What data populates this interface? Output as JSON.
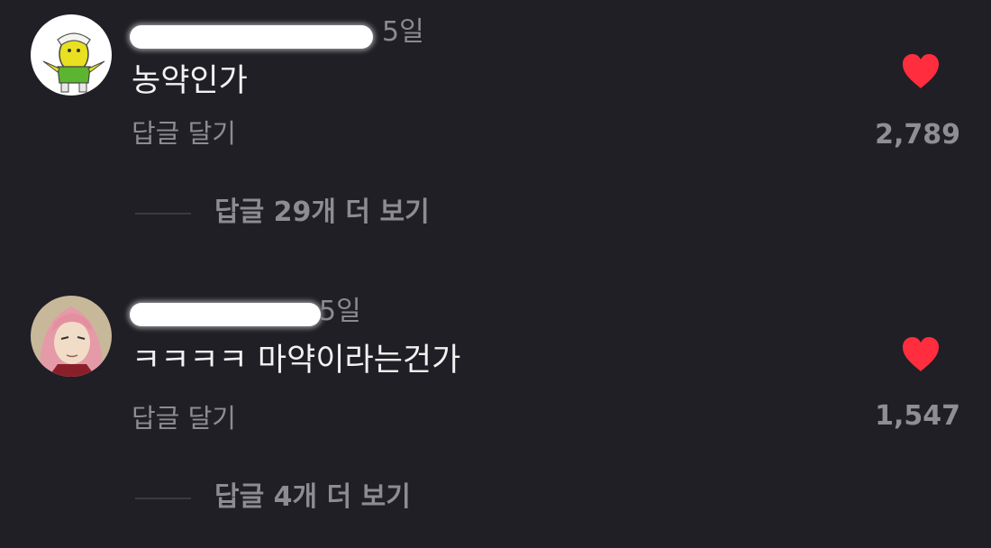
{
  "comments": [
    {
      "time": "5일",
      "text": "농약인가",
      "reply_label": "답글 달기",
      "likes": "2,789",
      "more_replies": "답글 29개 더 보기",
      "heart_icon": "heart-icon",
      "accent": "#ff2d3d"
    },
    {
      "time": "5일",
      "text": "ㅋㅋㅋㅋ 마약이라는건가",
      "reply_label": "답글 달기",
      "likes": "1,547",
      "more_replies": "답글 4개 더 보기",
      "heart_icon": "heart-icon",
      "accent": "#ff2d3d"
    }
  ]
}
